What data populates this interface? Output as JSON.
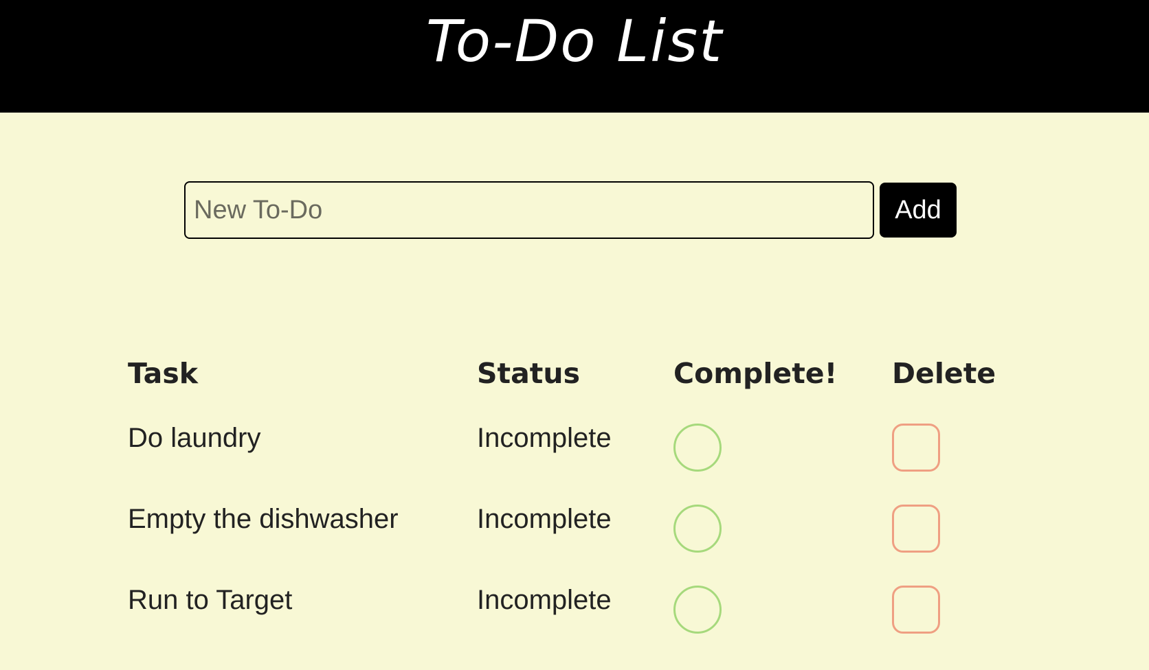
{
  "header": {
    "title": "To-Do List"
  },
  "form": {
    "input_value": "",
    "input_placeholder": "New To-Do",
    "add_label": "Add"
  },
  "table": {
    "columns": {
      "task": "Task",
      "status": "Status",
      "complete": "Complete!",
      "delete": "Delete"
    },
    "rows": [
      {
        "task": "Do laundry",
        "status": "Incomplete"
      },
      {
        "task": "Empty the dishwasher",
        "status": "Incomplete"
      },
      {
        "task": "Run to Target",
        "status": "Incomplete"
      }
    ]
  },
  "colors": {
    "header_bg": "#000000",
    "page_bg": "#f8f8d5",
    "complete_green": "#a6d97c",
    "delete_salmon": "#ef9f82"
  }
}
